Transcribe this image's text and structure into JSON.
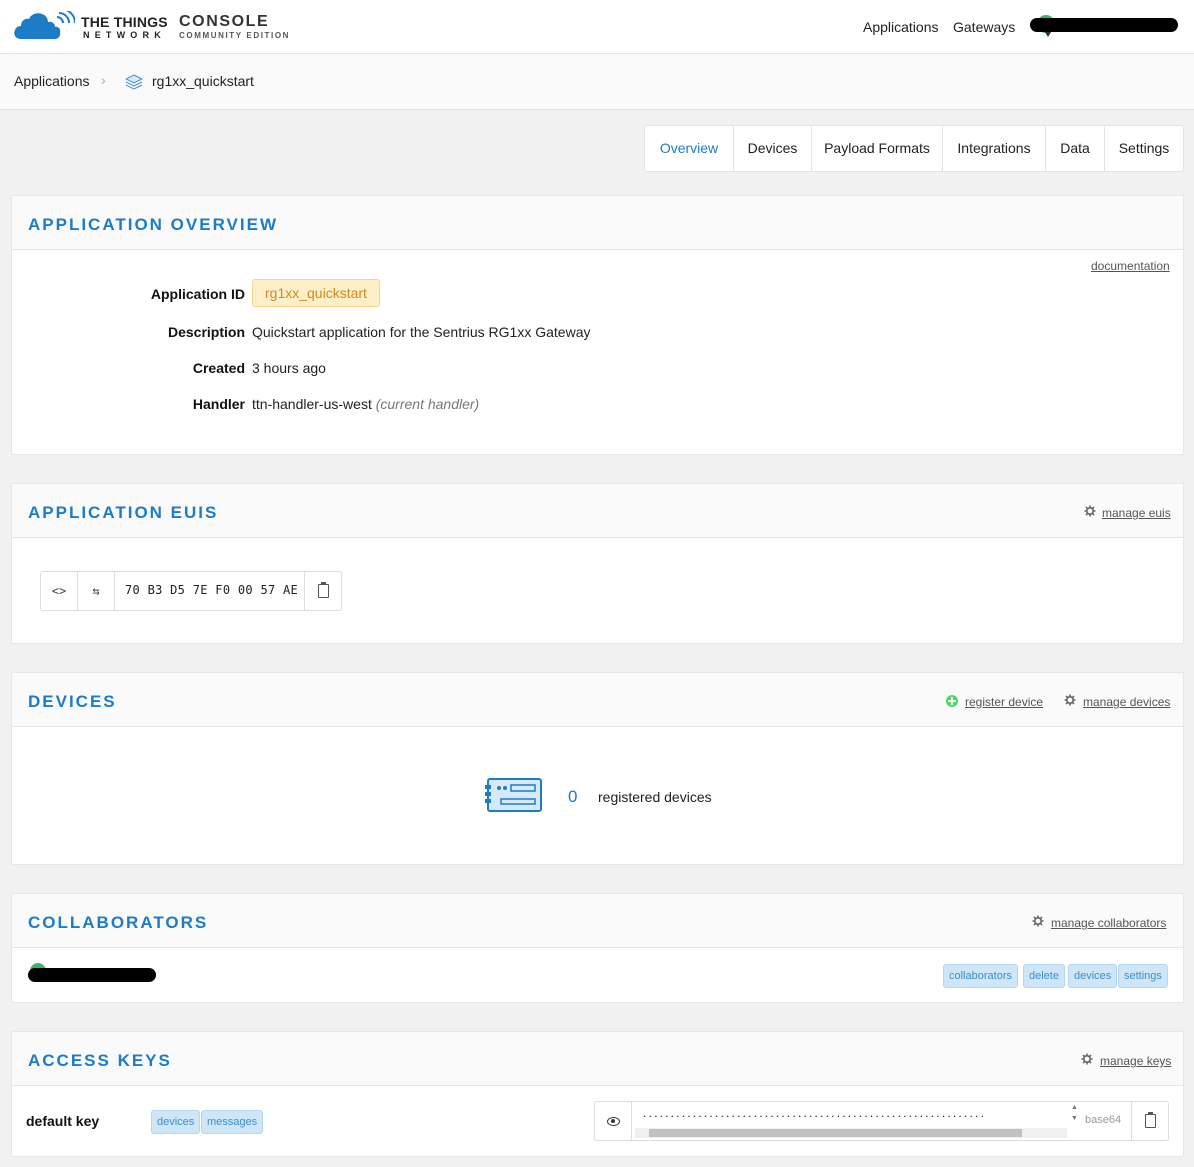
{
  "brand": {
    "line1": "THE THINGS",
    "line2": "NETWORK",
    "console": "CONSOLE",
    "edition": "COMMUNITY EDITION"
  },
  "topnav": {
    "applications": "Applications",
    "gateways": "Gateways"
  },
  "breadcrumb": {
    "root": "Applications",
    "separator": ">",
    "current": "rg1xx_quickstart"
  },
  "tabs": [
    "Overview",
    "Devices",
    "Payload Formats",
    "Integrations",
    "Data",
    "Settings"
  ],
  "active_tab": "Overview",
  "overview": {
    "title": "APPLICATION OVERVIEW",
    "doc_link": "documentation",
    "app_id_label": "Application ID",
    "app_id": "rg1xx_quickstart",
    "description_label": "Description",
    "description": "Quickstart application for the Sentrius RG1xx Gateway",
    "created_label": "Created",
    "created": "3 hours ago",
    "handler_label": "Handler",
    "handler": "ttn-handler-us-west",
    "handler_note": "(current handler)"
  },
  "euis": {
    "title": "APPLICATION EUIS",
    "manage_link": "manage euis",
    "eui_value": "70 B3 D5 7E F0 00 57 AE",
    "code_toggle": "<>",
    "swap_toggle": "⇆"
  },
  "devices": {
    "title": "DEVICES",
    "register_link": "register device",
    "manage_link": "manage devices",
    "count": "0",
    "count_label": "registered devices"
  },
  "collaborators": {
    "title": "COLLABORATORS",
    "manage_link": "manage collaborators",
    "rights": [
      "collaborators",
      "delete",
      "devices",
      "settings"
    ]
  },
  "access_keys": {
    "title": "ACCESS KEYS",
    "manage_link": "manage keys",
    "key_name": "default key",
    "rights": [
      "devices",
      "messages"
    ],
    "masked_value": "..............................................................",
    "format": "base64"
  },
  "colors": {
    "accent": "#1c7cc8",
    "badge_bg": "#fdefc8",
    "badge_text": "#d08a1c",
    "chip_bg": "#cfe6f8",
    "add_green": "#4cd964"
  }
}
